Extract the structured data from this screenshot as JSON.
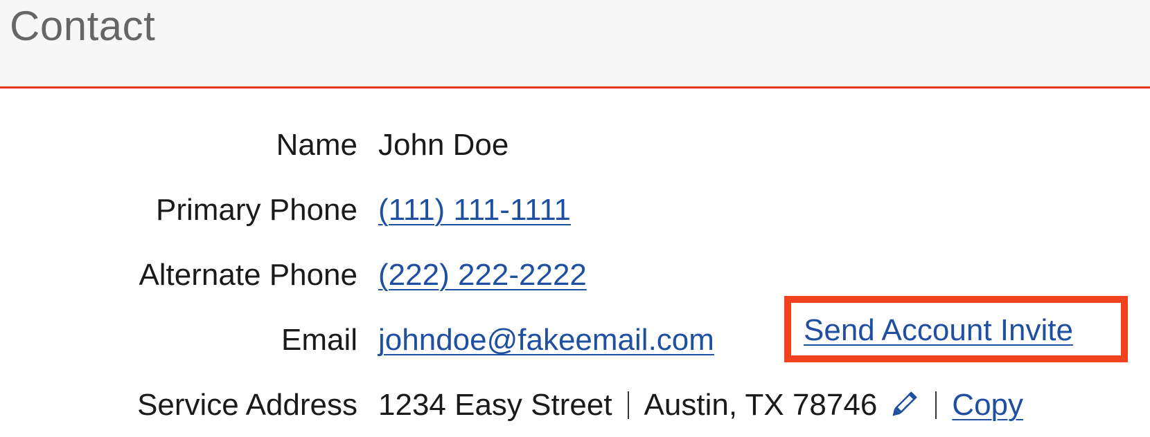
{
  "panel": {
    "title": "Contact"
  },
  "contact": {
    "name_label": "Name",
    "name_value": "John Doe",
    "primary_phone_label": "Primary Phone",
    "primary_phone_value": "(111) 111-1111",
    "alternate_phone_label": "Alternate Phone",
    "alternate_phone_value": "(222) 222-2222",
    "email_label": "Email",
    "email_value": "johndoe@fakeemail.com",
    "send_invite_label": "Send Account Invite",
    "service_address_label": "Service Address",
    "address_street": "1234 Easy Street",
    "address_city": "Austin, TX 78746",
    "copy_label": "Copy"
  },
  "icons": {
    "edit": "pencil-icon"
  },
  "colors": {
    "header_border": "#e8321c",
    "highlight_box": "#f0421c",
    "link": "#1f4fa0",
    "header_bg": "#f7f7f7"
  }
}
